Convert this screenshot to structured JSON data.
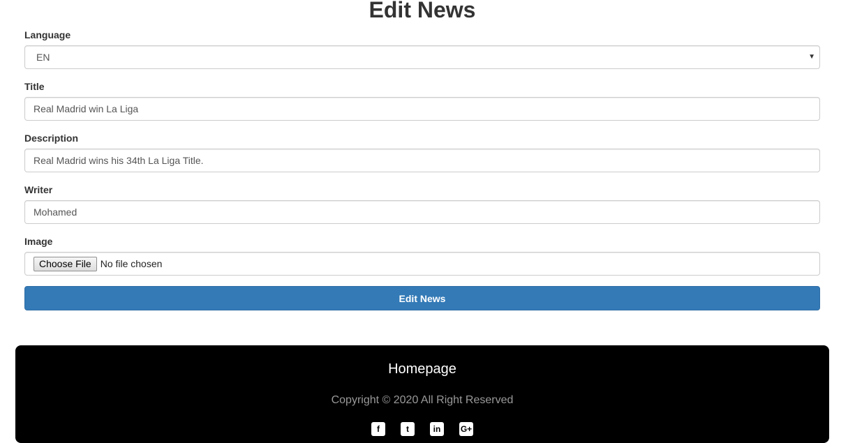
{
  "page": {
    "title": "Edit News"
  },
  "form": {
    "language": {
      "label": "Language",
      "value": "EN"
    },
    "title": {
      "label": "Title",
      "value": "Real Madrid win La Liga"
    },
    "description": {
      "label": "Description",
      "value": "Real Madrid wins his 34th La Liga Title."
    },
    "writer": {
      "label": "Writer",
      "value": "Mohamed"
    },
    "image": {
      "label": "Image",
      "button_label": "Choose File",
      "status": "No file chosen"
    },
    "submit_label": "Edit News"
  },
  "footer": {
    "home_link": "Homepage",
    "copyright": "Copyright © 2020 All Right Reserved",
    "social": [
      {
        "icon": "facebook-icon",
        "glyph": "f"
      },
      {
        "icon": "twitter-icon",
        "glyph": "t"
      },
      {
        "icon": "linkedin-icon",
        "glyph": "in"
      },
      {
        "icon": "google-plus-icon",
        "glyph": "G+"
      }
    ]
  },
  "colors": {
    "primary": "#337ab7",
    "footer_bg": "#000000"
  }
}
